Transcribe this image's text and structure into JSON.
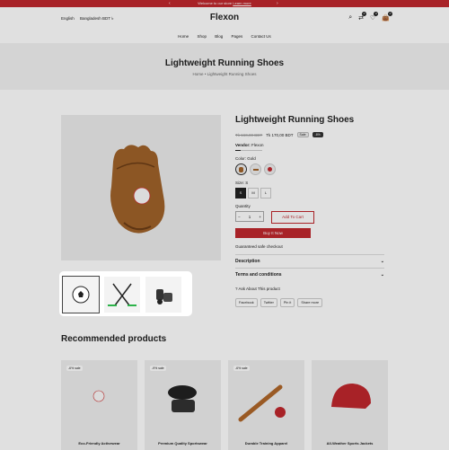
{
  "announcement": {
    "text": "Welcome to our store",
    "link": "Learn more"
  },
  "header": {
    "language": "English",
    "currency": "Bangladesh BDT ৳",
    "logo": "Flexon",
    "cart_count": "0",
    "wishlist_count": "0",
    "compare_count": "0"
  },
  "nav": {
    "items": [
      "Home",
      "Shop",
      "Blog",
      "Pages",
      "Contact Us"
    ]
  },
  "hero": {
    "title": "Lightweight Running Shoes",
    "crumb_home": "Home",
    "crumb_sep": "•",
    "crumb_current": "Lightweight Running Shoes"
  },
  "product": {
    "title": "Lightweight Running Shoes",
    "old_price": "Tk 160,00 BDT",
    "price": "Tk 170,00 BDT",
    "sale_tag": "Sale",
    "discount_tag": "-6%",
    "vendor_label": "Vendor:",
    "vendor": "Flexon",
    "color_label": "Color:",
    "color_value": "Gold",
    "size_label": "Size:",
    "size_value": "S",
    "sizes": [
      "S",
      "M",
      "L"
    ],
    "quantity_label": "Quantity",
    "quantity": "1",
    "add_to_cart": "Add To Cart",
    "buy_now": "Buy It Now",
    "guarantee": "Guaranteed safe checkout",
    "description": "Description",
    "terms": "Terms and conditions",
    "ask": "Ask About This product",
    "shares": [
      "Facebook",
      "Twitter",
      "Pin it",
      "Share more"
    ]
  },
  "recommended": {
    "title": "Recommended products",
    "cards": [
      {
        "tag": "-6% sale",
        "name": "Eco-Friendly Activewear"
      },
      {
        "tag": "-9% sale",
        "name": "Premium Quality Sportswear"
      },
      {
        "tag": "-6% sale",
        "name": "Durable Training Apparel"
      },
      {
        "tag": "",
        "name": "All-Weather Sports Jackets"
      }
    ]
  },
  "colors": {
    "brand": "#c0272d",
    "hero_bg": "#f2f2f2",
    "card_bg": "#eeeeee"
  }
}
